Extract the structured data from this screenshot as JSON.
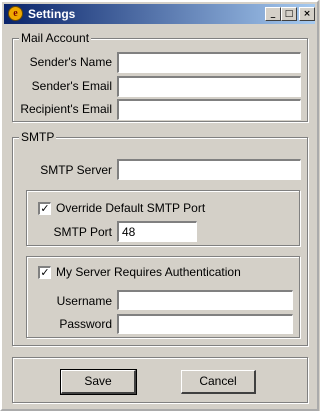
{
  "window": {
    "title": "Settings",
    "app_icon_glyph": "e",
    "minimize_glyph": "_",
    "maximize_glyph": "□",
    "close_glyph": "×"
  },
  "mail_account": {
    "legend": "Mail Account",
    "senders_name_label": "Sender's Name",
    "senders_name_value": "",
    "senders_email_label": "Sender's Email",
    "senders_email_value": "",
    "recipients_email_label": "Recipient's Email",
    "recipients_email_value": ""
  },
  "smtp": {
    "legend": "SMTP",
    "server_label": "SMTP Server",
    "server_value": "",
    "override_port_label": "Override Default SMTP Port",
    "override_port_checked": true,
    "check_glyph": "✓",
    "port_label": "SMTP Port",
    "port_value": "48",
    "auth_label": "My Server Requires Authentication",
    "auth_checked": true,
    "username_label": "Username",
    "username_value": "",
    "password_label": "Password",
    "password_value": ""
  },
  "buttons": {
    "save_label": "Save",
    "cancel_label": "Cancel"
  }
}
